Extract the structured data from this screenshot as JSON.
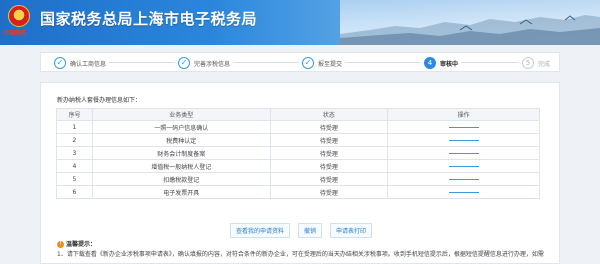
{
  "header": {
    "title": "国家税务总局上海市电子税务局",
    "emblem_caption": "中国税务"
  },
  "steps": [
    {
      "label": "确认工商信息",
      "state": "done"
    },
    {
      "label": "完善涉税信息",
      "state": "done"
    },
    {
      "label": "报至提交",
      "state": "done"
    },
    {
      "label": "审核中",
      "number": "4",
      "state": "current"
    },
    {
      "label": "完成",
      "number": "5",
      "state": "todo"
    }
  ],
  "intro": "新办纳税人套餐办理信息如下：",
  "table": {
    "headers": [
      "序号",
      "业务类型",
      "状态",
      "操作"
    ],
    "rows": [
      [
        "1",
        "一照一码户信息确认",
        "待受理"
      ],
      [
        "2",
        "税费种认定",
        "待受理"
      ],
      [
        "3",
        "财务会计制度备案",
        "待受理"
      ],
      [
        "4",
        "增值税一般纳税人登记",
        "待受理"
      ],
      [
        "5",
        "扣缴税款登记",
        "待受理"
      ],
      [
        "6",
        "电子发票开具",
        "待受理"
      ]
    ]
  },
  "buttons": {
    "view": "查看我的申请资料",
    "withdraw": "撤销",
    "print": "申请表打印"
  },
  "tips": {
    "title": "温馨提示：",
    "line1": "1、请下载查看《新办企业涉税事项申请表》，确认填报的内容，对符合条件的新办企业，可在受理后的当天办结相关涉税事项。收到手机短信提示后，根据短信提醒信息进行办理，如需"
  },
  "colors": {
    "accent": "#2c8be0",
    "header": "#1f6fc8"
  }
}
